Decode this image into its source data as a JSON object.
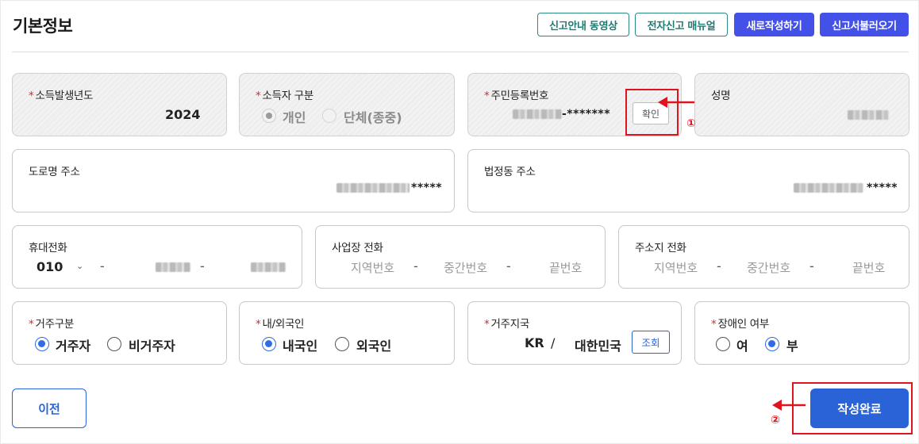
{
  "header": {
    "title": "기본정보",
    "buttons": {
      "video_guide": "신고안내 동영상",
      "manual": "전자신고 매뉴얼",
      "new_write": "새로작성하기",
      "load": "신고서불러오기"
    }
  },
  "fields": {
    "income_year": {
      "label": "소득발생년도",
      "value": "2024"
    },
    "income_type": {
      "label": "소득자 구분",
      "options": [
        "개인",
        "단체(종중)"
      ],
      "selected": "개인"
    },
    "rrn": {
      "label": "주민등록번호",
      "masked": "-*******",
      "confirm_label": "확인"
    },
    "name": {
      "label": "성명"
    },
    "road_address": {
      "label": "도로명 주소",
      "masked": "*****"
    },
    "lot_address": {
      "label": "법정동 주소",
      "masked": "*****"
    },
    "mobile": {
      "label": "휴대전화",
      "prefix": "010",
      "sep1": "-",
      "sep2": "-"
    },
    "work_phone": {
      "label": "사업장 전화",
      "ph_area": "지역번호",
      "ph_mid": "중간번호",
      "ph_end": "끝번호",
      "sep": "-"
    },
    "home_phone": {
      "label": "주소지 전화",
      "ph_area": "지역번호",
      "ph_mid": "중간번호",
      "ph_end": "끝번호",
      "sep": "-"
    },
    "residence": {
      "label": "거주구분",
      "options": [
        "거주자",
        "비거주자"
      ],
      "selected": "거주자"
    },
    "nationality": {
      "label": "내/외국인",
      "options": [
        "내국인",
        "외국인"
      ],
      "selected": "내국인"
    },
    "residence_country": {
      "label": "거주지국",
      "code": "KR",
      "slash": "/",
      "country": "대한민국",
      "lookup_label": "조회"
    },
    "disability": {
      "label": "장애인 여부",
      "options": [
        "여",
        "부"
      ],
      "selected": "부"
    }
  },
  "required_mark": "*",
  "footer": {
    "prev_label": "이전",
    "done_label": "작성완료"
  },
  "annotations": {
    "marker1": "①",
    "marker2": "②",
    "color": "#e0141e"
  },
  "colors": {
    "primary": "#2a63d8",
    "header_solid": "#4351e8",
    "header_outline": "#2b8a80"
  }
}
